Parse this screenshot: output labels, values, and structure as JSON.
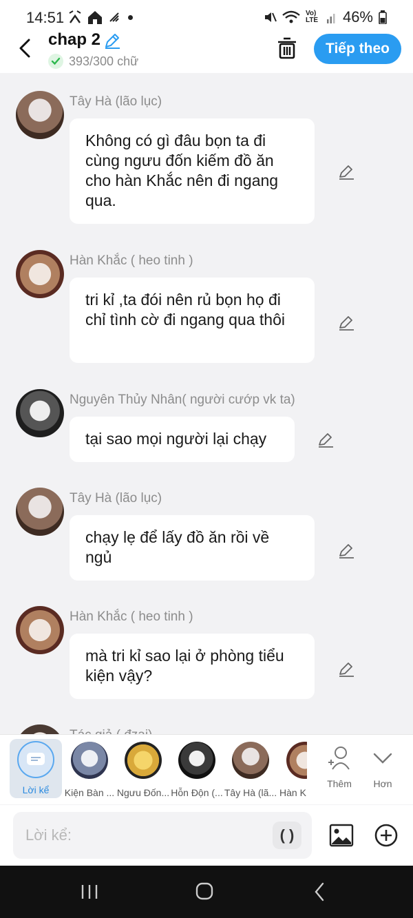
{
  "status": {
    "time": "14:51",
    "battery": "46%",
    "carrier": "Vo) LTE"
  },
  "header": {
    "title": "chap 2",
    "word_count": "393/300 chữ",
    "next_label": "Tiếp theo"
  },
  "messages": [
    {
      "sender": "Tây Hà (lão lục)",
      "text": "Không có gì đâu bọn ta đi cùng ngưu đốn kiếm đồ ăn cho hàn Khắc nên đi ngang qua.",
      "avatar": "tay-ha-avatar"
    },
    {
      "sender": "Hàn Khắc ( heo tinh )",
      "text": "tri kỉ ,ta đói nên rủ bọn họ đi chỉ tình cờ đi ngang qua thôi",
      "avatar": "han-khac-avatar"
    },
    {
      "sender": "Nguyên Thủy Nhân( người cướp vk ta)",
      "text": "tại sao mọi người lại chạy",
      "avatar": "nguyen-thuy-nhan-avatar"
    },
    {
      "sender": "Tây Hà (lão lục)",
      "text": "chạy lẹ để lấy đồ ăn rồi về ngủ",
      "avatar": "tay-ha-avatar"
    },
    {
      "sender": "Hàn Khắc ( heo tinh )",
      "text": "mà tri kỉ sao lại ở phòng tiểu kiện vậy?",
      "avatar": "han-khac-avatar"
    },
    {
      "sender": "Tác giả ( đzai)",
      "text": "",
      "avatar": "author-avatar"
    }
  ],
  "characters": {
    "narration_label": "Lời kể",
    "items": [
      {
        "label": "Kiện Bàn ...",
        "color": "#7a87a6"
      },
      {
        "label": "Ngưu Đốn...",
        "color": "#d9a93a"
      },
      {
        "label": "Hỗn Độn (...",
        "color": "#3a3a3a"
      },
      {
        "label": "Tây Hà (lã...",
        "color": "#8b6b5a"
      },
      {
        "label": "Hàn K",
        "color": "#b08060"
      }
    ],
    "add_label": "Thêm",
    "more_label": "Hơn"
  },
  "composer": {
    "placeholder": "Lời kể:",
    "paren_label": "( )"
  },
  "colors": {
    "accent": "#2a9cf1",
    "bubble": "#ffffff",
    "background": "#f2f2f4"
  }
}
